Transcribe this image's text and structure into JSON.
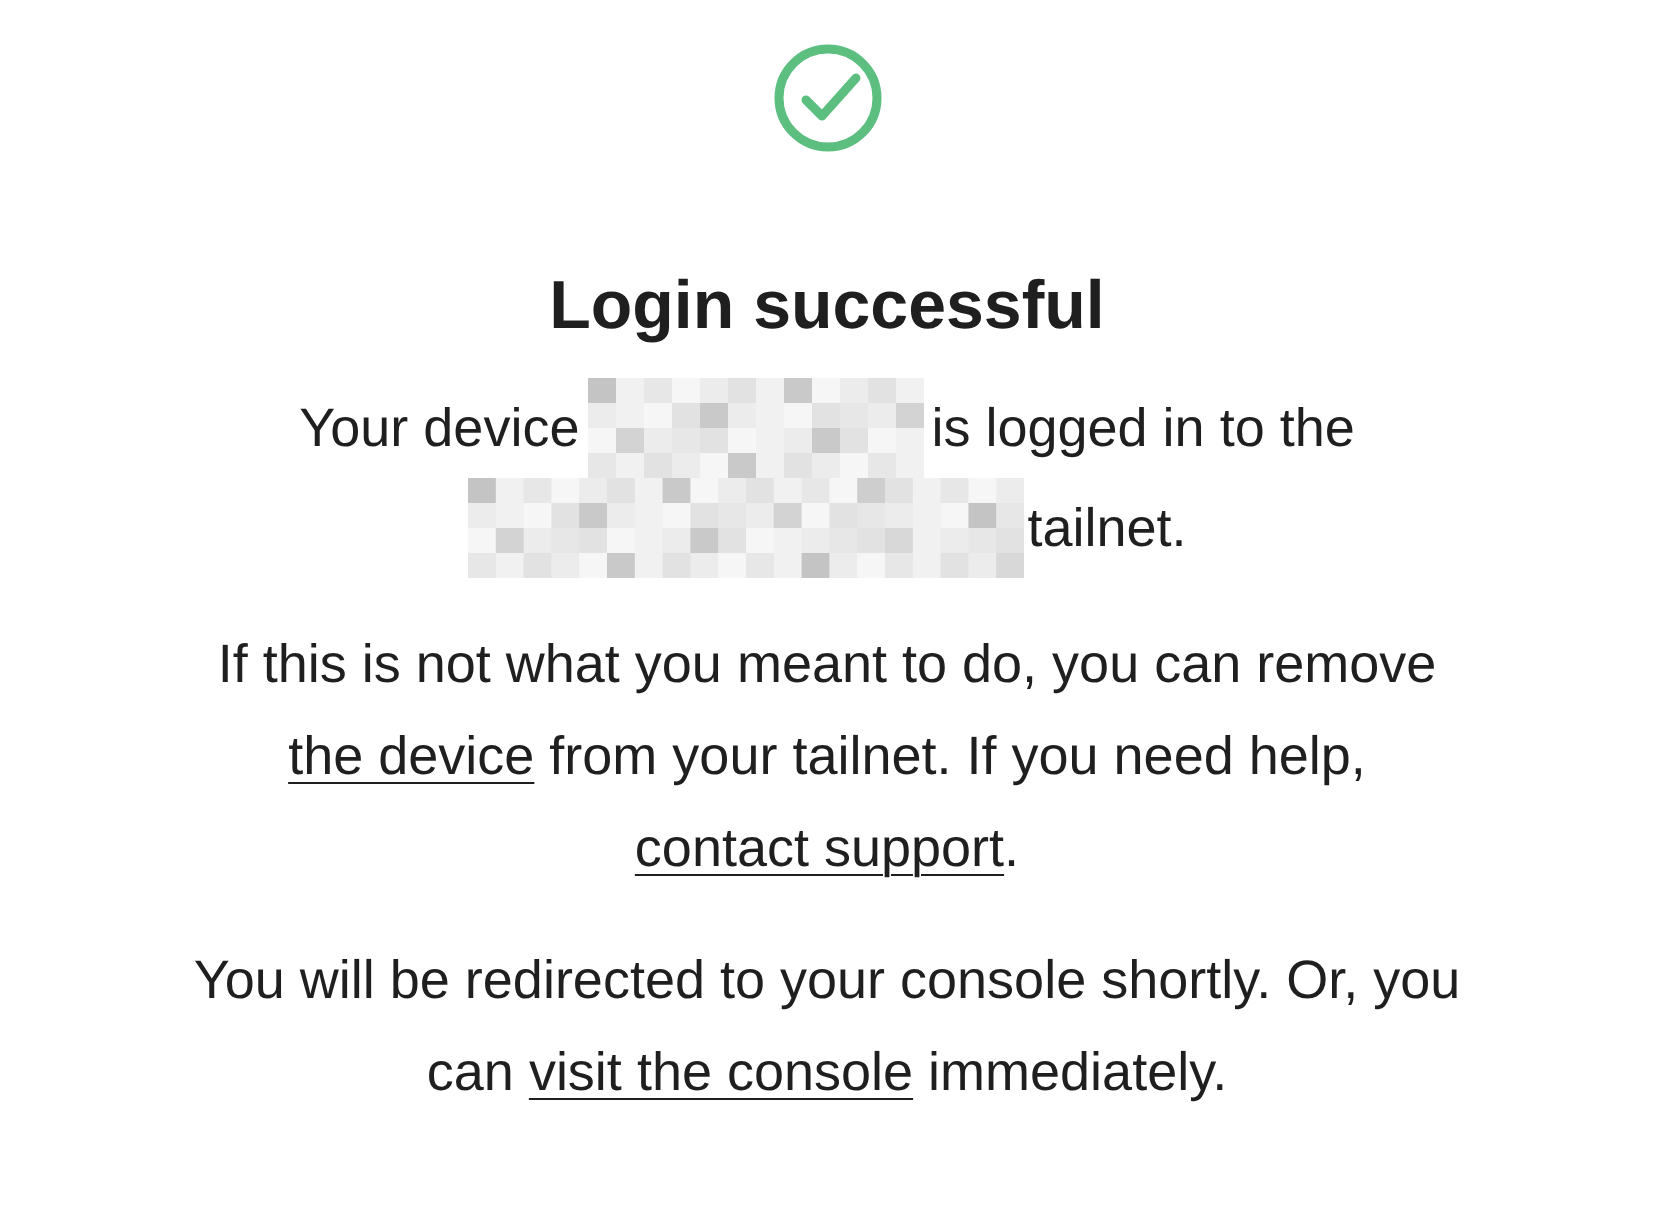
{
  "title": "Login successful",
  "status": {
    "before": "Your device",
    "middle": "is logged in to the",
    "after": "tailnet."
  },
  "notice": [
    {
      "kind": "text",
      "text": "If this is not what you meant to do, you can remove "
    },
    {
      "kind": "link",
      "text": "the device"
    },
    {
      "kind": "text",
      "text": " from your tailnet. If you need help, "
    },
    {
      "kind": "link",
      "text": "contact support"
    },
    {
      "kind": "text",
      "text": "."
    }
  ],
  "redirect": [
    {
      "kind": "text",
      "text": "You will be redirected to your console shortly. Or, you can "
    },
    {
      "kind": "link",
      "text": "visit the console"
    },
    {
      "kind": "text",
      "text": " immediately."
    }
  ]
}
